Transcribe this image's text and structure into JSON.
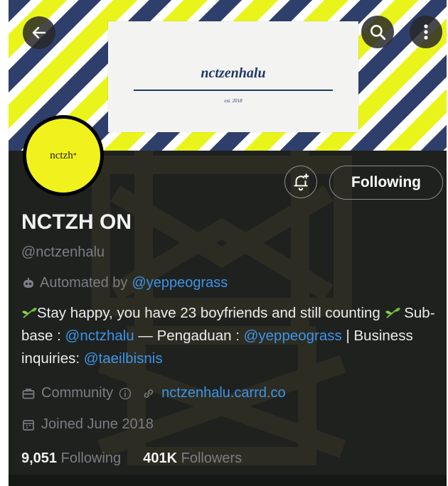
{
  "banner": {
    "title": "nctzenhalu",
    "subtitle": "est. 2018",
    "colors": {
      "navy": "#2f3f6b",
      "yellow": "#e9f51a"
    }
  },
  "toolbar": {
    "back_icon": "arrow-left-icon",
    "search_icon": "search-icon",
    "more_icon": "more-vertical-icon"
  },
  "avatar": {
    "text": "nctzh",
    "mark": "*"
  },
  "actions": {
    "notify_icon": "bell-plus-icon",
    "follow_label": "Following"
  },
  "profile": {
    "name": "NCTZH ON",
    "handle": "@nctzenhalu",
    "automated_prefix": "Automated by",
    "automated_by": "@yeppeograss",
    "bio": {
      "part1": "Stay happy, you have 23 boyfriends and still counting",
      "part2": " Sub-base : ",
      "mention1": "@nctzhalu",
      "part3": " — Pengaduan : ",
      "mention2": "@yeppeograss",
      "part4": " | Business inquiries: ",
      "mention3": "@taeilbisnis"
    },
    "category": "Community",
    "website": "nctzenhalu.carrd.co",
    "joined": "Joined June 2018",
    "following_count": "9,051",
    "following_label": "Following",
    "followers_count": "401K",
    "followers_label": "Followers"
  },
  "colors": {
    "link": "#3b95e8",
    "background": "#1f211f",
    "muted": "#7b7e82"
  }
}
